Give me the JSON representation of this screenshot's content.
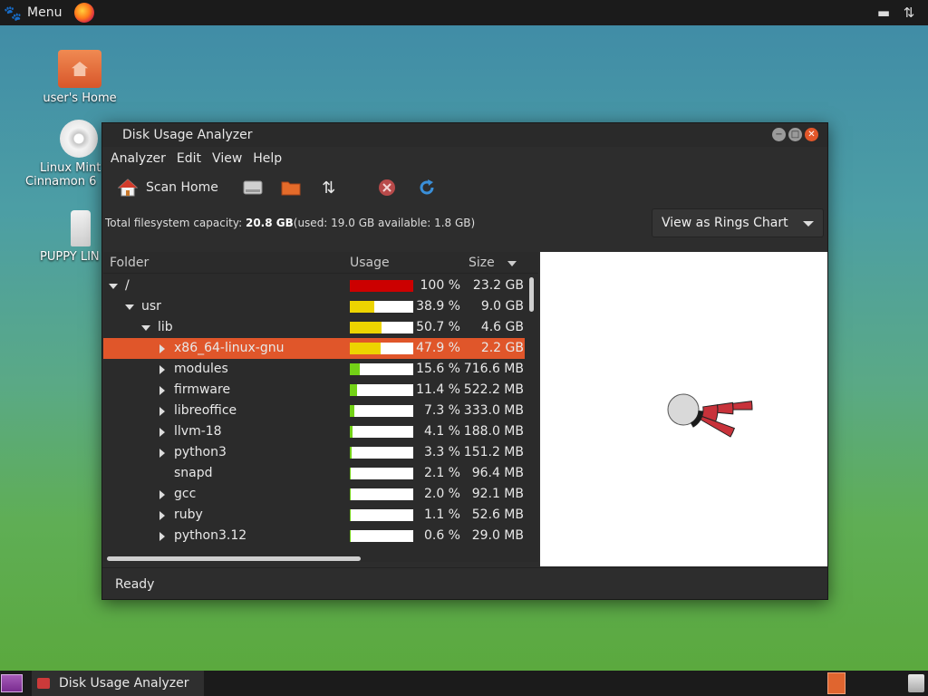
{
  "top_panel": {
    "menu_label": "Menu",
    "menu_icon": "mint-foot-icon",
    "browser_icon": "firefox-icon",
    "tray_icons": [
      "usb-drive-icon",
      "network-arrows-icon"
    ]
  },
  "desktop": {
    "icons": [
      {
        "label": "user's Home",
        "icon": "home-folder-icon"
      },
      {
        "label_lines": [
          "Linux Mint",
          "Cinnamon 6"
        ],
        "icon": "dvd-icon"
      },
      {
        "label": "PUPPY LIN",
        "icon": "usb-drive-icon"
      }
    ]
  },
  "window": {
    "title": "Disk Usage Analyzer",
    "controls": [
      "minimize-icon",
      "maximize-icon",
      "close-icon"
    ],
    "menus": [
      "Analyzer",
      "Edit",
      "View",
      "Help"
    ],
    "toolbar": {
      "scan_home_label": "Scan Home",
      "icons": [
        "scan-home-icon",
        "scan-filesystem-icon",
        "scan-folder-icon",
        "scan-remote-icon",
        "stop-icon",
        "refresh-icon"
      ]
    },
    "info": {
      "prefix": "Total filesystem capacity: ",
      "capacity": "20.8 GB",
      "detail": " (used: 19.0 GB available: 1.8 GB)"
    },
    "view_select": "View as Rings Chart",
    "tree": {
      "columns": {
        "folder": "Folder",
        "usage": "Usage",
        "size": "Size"
      },
      "rows": [
        {
          "name": "/",
          "depth": 0,
          "expander": "open",
          "usage": 100,
          "color": "#cc0000",
          "pct": "100 %",
          "size": "23.2 GB"
        },
        {
          "name": "usr",
          "depth": 1,
          "expander": "open",
          "usage": 38.9,
          "color": "#edd400",
          "pct": "38.9 %",
          "size": "9.0 GB"
        },
        {
          "name": "lib",
          "depth": 2,
          "expander": "open",
          "usage": 50.7,
          "color": "#edd400",
          "pct": "50.7 %",
          "size": "4.6 GB"
        },
        {
          "name": "x86_64-linux-gnu",
          "depth": 3,
          "expander": "closed",
          "usage": 47.9,
          "color": "#edd400",
          "pct": "47.9 %",
          "size": "2.2 GB",
          "selected": true
        },
        {
          "name": "modules",
          "depth": 3,
          "expander": "closed",
          "usage": 15.6,
          "color": "#73d216",
          "pct": "15.6 %",
          "size": "716.6 MB"
        },
        {
          "name": "firmware",
          "depth": 3,
          "expander": "closed",
          "usage": 11.4,
          "color": "#73d216",
          "pct": "11.4 %",
          "size": "522.2 MB"
        },
        {
          "name": "libreoffice",
          "depth": 3,
          "expander": "closed",
          "usage": 7.3,
          "color": "#73d216",
          "pct": "7.3 %",
          "size": "333.0 MB"
        },
        {
          "name": "llvm-18",
          "depth": 3,
          "expander": "closed",
          "usage": 4.1,
          "color": "#73d216",
          "pct": "4.1 %",
          "size": "188.0 MB"
        },
        {
          "name": "python3",
          "depth": 3,
          "expander": "closed",
          "usage": 3.3,
          "color": "#73d216",
          "pct": "3.3 %",
          "size": "151.2 MB"
        },
        {
          "name": "snapd",
          "depth": 3,
          "expander": "none",
          "usage": 2.1,
          "color": "#73d216",
          "pct": "2.1 %",
          "size": "96.4 MB"
        },
        {
          "name": "gcc",
          "depth": 3,
          "expander": "closed",
          "usage": 2.0,
          "color": "#73d216",
          "pct": "2.0 %",
          "size": "92.1 MB"
        },
        {
          "name": "ruby",
          "depth": 3,
          "expander": "closed",
          "usage": 1.1,
          "color": "#73d216",
          "pct": "1.1 %",
          "size": "52.6 MB"
        },
        {
          "name": "python3.12",
          "depth": 3,
          "expander": "closed",
          "usage": 0.6,
          "color": "#73d216",
          "pct": "0.6 %",
          "size": "29.0 MB"
        }
      ]
    },
    "status": "Ready"
  },
  "taskbar": {
    "task_label": "Disk Usage Analyzer"
  }
}
